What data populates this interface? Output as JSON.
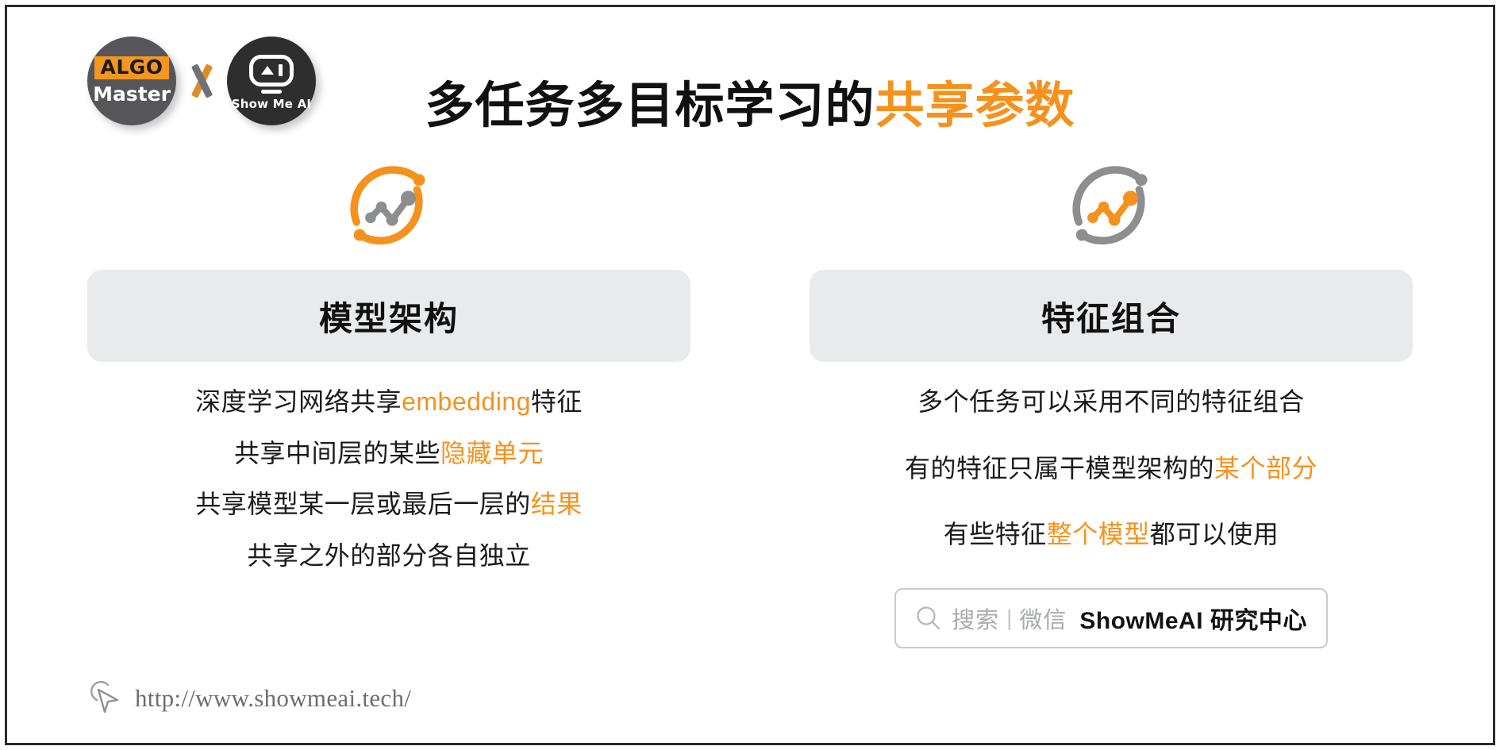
{
  "header": {
    "logo_left": {
      "tag": "ALGO",
      "name": "Master"
    },
    "separator": "x",
    "logo_right": {
      "name": "Show Me AI"
    }
  },
  "title": {
    "plain": "多任务多目标学习的",
    "accent": "共享参数"
  },
  "colors": {
    "accent": "#f5921e",
    "text": "#1b1b1b",
    "card_bg": "#e9eaeb",
    "muted": "#a9abae",
    "icon_gray": "#8c8e90"
  },
  "columns": [
    {
      "icon": "line-chart-circle-icon",
      "icon_style": "orange-ring-gray-chart",
      "heading": "模型架构",
      "bullets": [
        [
          {
            "text": "深度学习网络共享",
            "accent": false
          },
          {
            "text": "embedding",
            "accent": true
          },
          {
            "text": "特征",
            "accent": false
          }
        ],
        [
          {
            "text": "共享中间层的某些",
            "accent": false
          },
          {
            "text": "隐藏单元",
            "accent": true
          }
        ],
        [
          {
            "text": "共享模型某一层或最后一层的",
            "accent": false
          },
          {
            "text": "结果",
            "accent": true
          }
        ],
        [
          {
            "text": "共享之外的部分各自独立",
            "accent": false
          }
        ]
      ]
    },
    {
      "icon": "line-chart-circle-icon",
      "icon_style": "gray-ring-orange-chart",
      "heading": "特征组合",
      "bullets": [
        [
          {
            "text": "多个任务可以采用不同的特征组合",
            "accent": false
          }
        ],
        [
          {
            "text": "有的特征只属干模型架构的",
            "accent": false
          },
          {
            "text": "某个部分",
            "accent": true
          }
        ],
        [
          {
            "text": "有些特征",
            "accent": false
          },
          {
            "text": "整个模型",
            "accent": true
          },
          {
            "text": "都可以使用",
            "accent": false
          }
        ]
      ]
    }
  ],
  "search_badge": {
    "icon": "search-icon",
    "placeholder": "搜索",
    "divider": "|",
    "channel": "微信",
    "brand": "ShowMeAI 研究中心"
  },
  "footer": {
    "icon": "cursor-pointer-icon",
    "url": "http://www.showmeai.tech/"
  }
}
